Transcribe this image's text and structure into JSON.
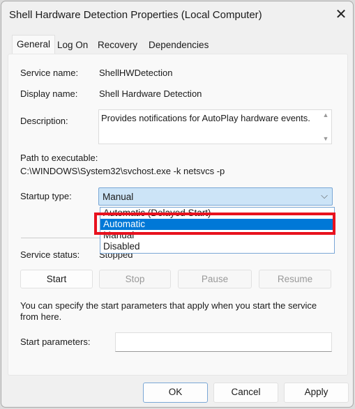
{
  "window": {
    "title": "Shell Hardware Detection Properties (Local Computer)",
    "close_icon": "close-icon"
  },
  "tabs": [
    {
      "label": "General",
      "selected": true
    },
    {
      "label": "Log On"
    },
    {
      "label": "Recovery"
    },
    {
      "label": "Dependencies"
    }
  ],
  "general": {
    "service_name_label": "Service name:",
    "service_name": "ShellHWDetection",
    "display_name_label": "Display name:",
    "display_name": "Shell Hardware Detection",
    "description_label": "Description:",
    "description": "Provides notifications for AutoPlay hardware events.",
    "path_label": "Path to executable:",
    "path": "C:\\WINDOWS\\System32\\svchost.exe -k netsvcs -p",
    "startup_type_label": "Startup type:",
    "startup_type": "Manual",
    "startup_options": [
      "Automatic (Delayed Start)",
      "Automatic",
      "Manual",
      "Disabled"
    ],
    "highlighted_option": "Automatic",
    "highlight_color": "#e8111e",
    "service_status_label": "Service status:",
    "service_status": "Stopped",
    "buttons": {
      "start": "Start",
      "stop": "Stop",
      "pause": "Pause",
      "resume": "Resume"
    },
    "hint": "You can specify the start parameters that apply when you start the service from here.",
    "start_params_label": "Start parameters:",
    "start_params_value": ""
  },
  "footer": {
    "ok": "OK",
    "cancel": "Cancel",
    "apply": "Apply"
  }
}
